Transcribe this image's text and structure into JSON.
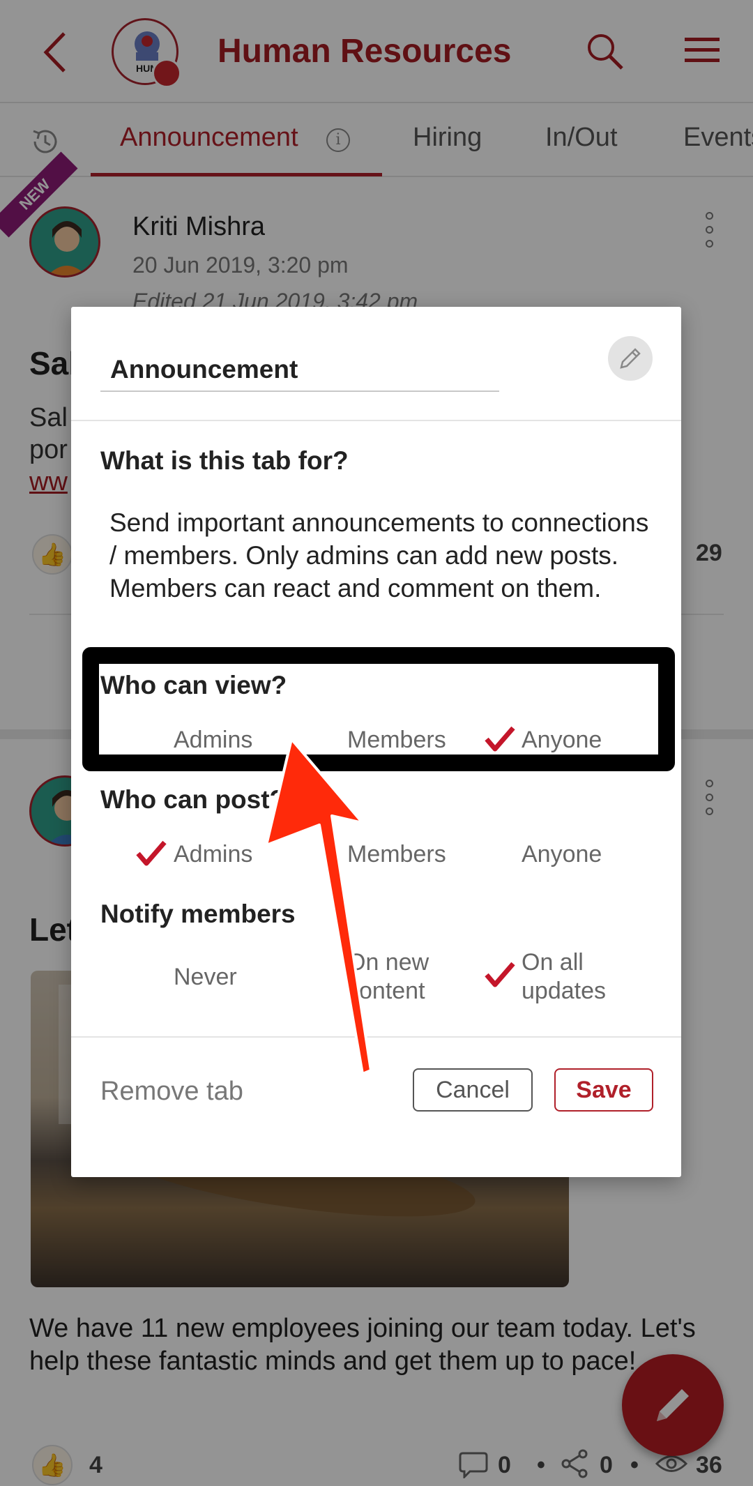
{
  "header": {
    "title": "Human Resources",
    "logo_text": "HUM"
  },
  "tabs": [
    {
      "label": "Announcement",
      "active": true
    },
    {
      "label": "Hiring"
    },
    {
      "label": "In/Out"
    },
    {
      "label": "Events"
    }
  ],
  "post1": {
    "badge": "NEW",
    "author": "Kriti Mishra",
    "date": "20 Jun 2019, 3:20 pm",
    "edited": "Edited 21 Jun 2019, 3:42 pm",
    "title_fragment": "Sal",
    "body_fragment_1": "Sal",
    "body_fragment_2": "por",
    "link_fragment": "ww",
    "views": "29"
  },
  "post2": {
    "title_fragment": "Let",
    "body": "We have 11 new employees joining our team today. Let's help these fantastic minds and get them up to pace!",
    "likes": "4",
    "comments": "0",
    "shares": "0",
    "views": "36"
  },
  "dialog": {
    "tab_name": "Announcement",
    "purpose_label": "What is this tab for?",
    "description": "Send important announcements to connections / members. Only admins can add new posts. Members can react and comment on them.",
    "view": {
      "label": "Who can view?",
      "options": [
        "Admins",
        "Members",
        "Anyone"
      ],
      "selected": "Anyone"
    },
    "post": {
      "label": "Who can post?",
      "options": [
        "Admins",
        "Members",
        "Anyone"
      ],
      "selected": "Admins"
    },
    "notify": {
      "label": "Notify members",
      "options": [
        "Never",
        "On new content",
        "On all updates"
      ],
      "selected": "On all updates"
    },
    "remove_tab": "Remove tab",
    "cancel": "Cancel",
    "save": "Save"
  },
  "colors": {
    "brand": "#b0202a",
    "annotation_arrow": "#ff2a0a",
    "highlight_box": "#000000"
  },
  "icons": [
    "back-arrow-icon",
    "search-icon",
    "hamburger-menu-icon",
    "history-icon",
    "info-icon",
    "kebab-menu-icon",
    "pencil-icon",
    "checkmark-icon",
    "thumbs-up-icon",
    "comment-icon",
    "share-icon",
    "eye-icon"
  ]
}
